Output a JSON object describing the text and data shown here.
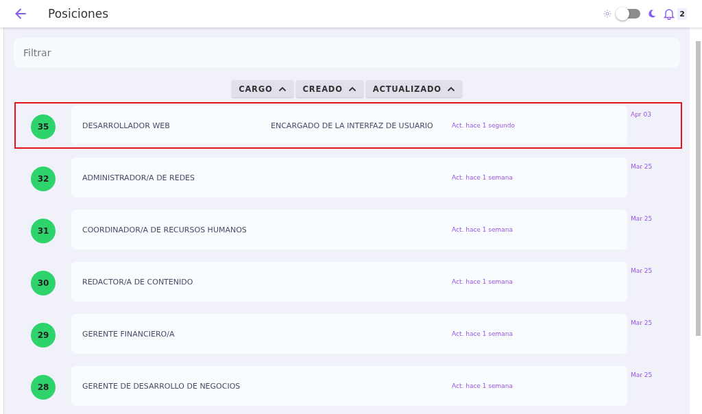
{
  "header": {
    "title": "Posiciones",
    "dark_mode": false,
    "notifications": "2"
  },
  "filter": {
    "placeholder": "Filtrar"
  },
  "sort_buttons": [
    {
      "label": "CARGO"
    },
    {
      "label": "CREADO"
    },
    {
      "label": "ACTUALIZADO"
    }
  ],
  "positions": [
    {
      "number": "35",
      "title": "DESARROLLADOR WEB",
      "description": "ENCARGADO DE LA INTERFAZ DE USUARIO",
      "updated": "Act. hace 1 segundo",
      "date": "Apr 03",
      "highlighted": true
    },
    {
      "number": "32",
      "title": "ADMINISTRADOR/A DE REDES",
      "updated": "Act. hace 1 semana",
      "date": "Mar 25",
      "highlighted": false
    },
    {
      "number": "31",
      "title": "COORDINADOR/A DE RECURSOS HUMANOS",
      "updated": "Act. hace 1 semana",
      "date": "Mar 25",
      "highlighted": false
    },
    {
      "number": "30",
      "title": "REDACTOR/A DE CONTENIDO",
      "updated": "Act. hace 1 semana",
      "date": "Mar 25",
      "highlighted": false
    },
    {
      "number": "29",
      "title": "GERENTE FINANCIERO/A",
      "updated": "Act. hace 1 semana",
      "date": "Mar 25",
      "highlighted": false
    },
    {
      "number": "28",
      "title": "GERENTE DE DESARROLLO DE NEGOCIOS",
      "updated": "Act. hace 1 semana",
      "date": "Mar 25",
      "highlighted": false
    }
  ]
}
